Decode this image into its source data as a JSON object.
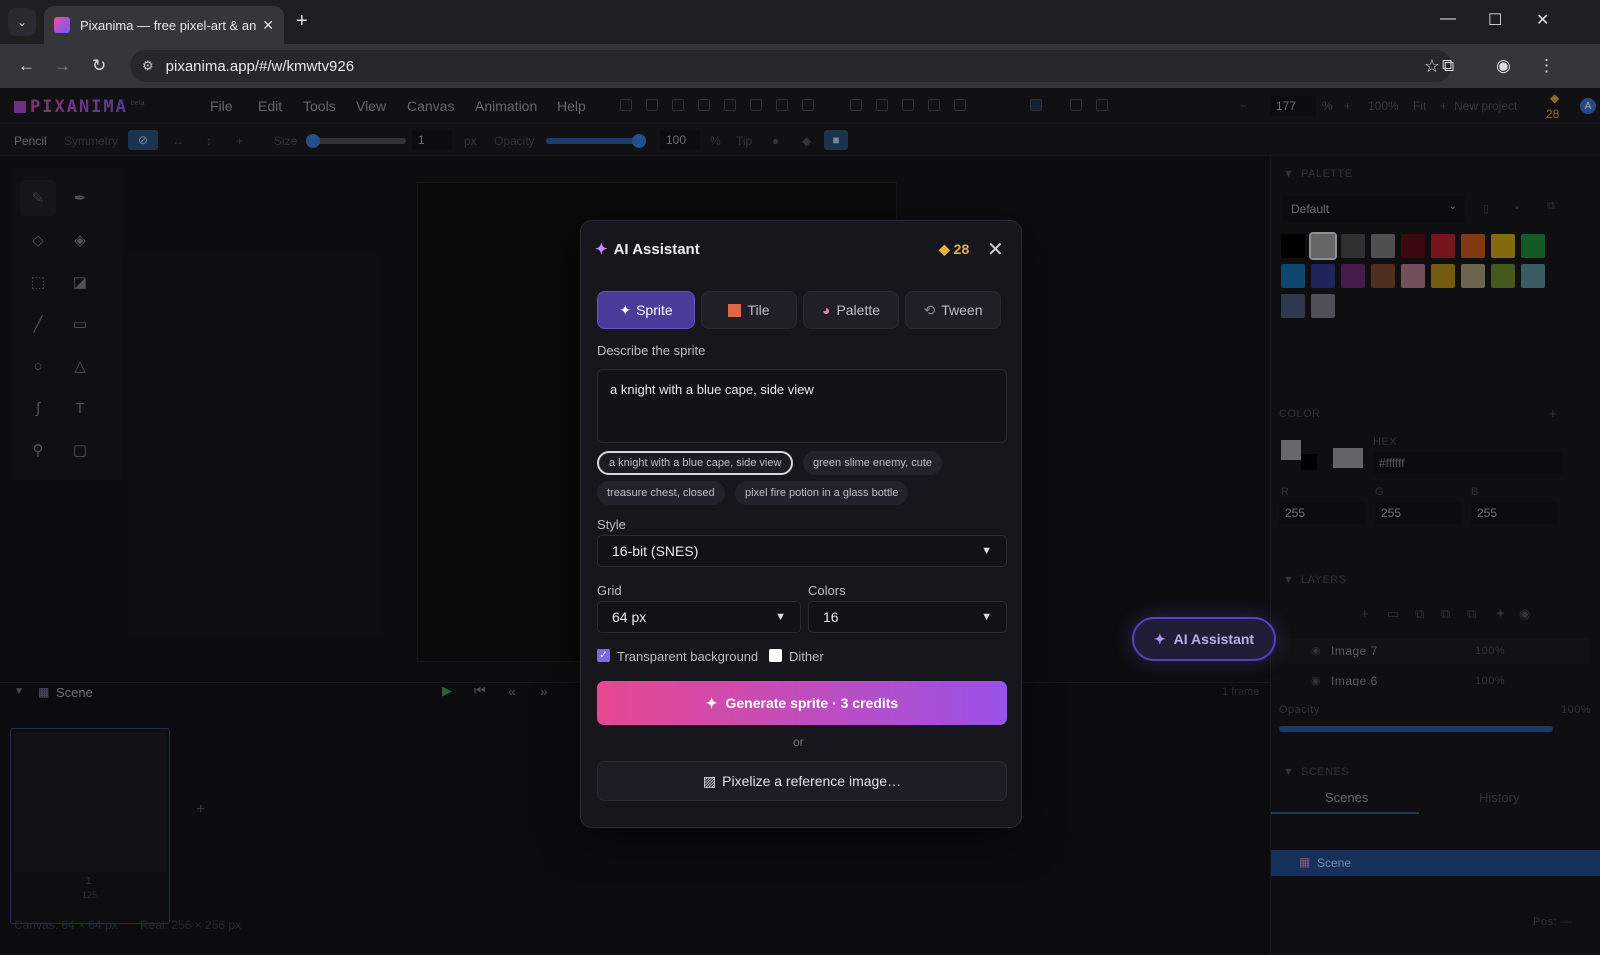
{
  "browser": {
    "tab_title": "Pixanima — free pixel-art & ani",
    "url": "pixanima.app/#/w/kmwtv926"
  },
  "app": {
    "logo": "PIXANIMA",
    "logo_tag": "beta",
    "menu": [
      "File",
      "Edit",
      "Tools",
      "View",
      "Canvas",
      "Animation",
      "Help"
    ],
    "zoom_value": "177",
    "zoom_unit": "%",
    "zoom_reset": "100%",
    "fit_label": "Fit",
    "new_project": "New project",
    "credits": "28",
    "avatar_letter": "A"
  },
  "tool_options": {
    "tool_name": "Pencil",
    "symmetry_label": "Symmetry",
    "size_label": "Size",
    "size_value": "1",
    "size_unit": "px",
    "opacity_label": "Opacity",
    "opacity_value": "100",
    "opacity_unit": "%",
    "tip_label": "Tip"
  },
  "timeline": {
    "scene_label": "Scene",
    "frames_label": "1 frame",
    "frame_number": "1",
    "frame_duration": "125"
  },
  "status": {
    "canvas_size": "Canvas: 64 × 64 px",
    "real_size": "Real: 256 × 256 px",
    "pos_label": "Pos: —"
  },
  "right_panel": {
    "palette_title": "PALETTE",
    "palette_name": "Default",
    "palette_colors": [
      "#000000",
      "#9d9d9d",
      "#4a4a4a",
      "#7a7a7a",
      "#5e0f1b",
      "#b81f2a",
      "#c95a1c",
      "#c9a418",
      "#1f8a3a",
      "#1a6fa8",
      "#2e3a8c",
      "#6e2a72",
      "#7a4a30",
      "#b07a8a",
      "#b08a18",
      "#a89a7a",
      "#6a8a28",
      "#5a8a9a",
      "#4a5a7a",
      "#7a7a8a"
    ],
    "color_title": "COLOR",
    "hex_label": "HEX",
    "hex_value": "#ffffff",
    "r_label": "R",
    "g_label": "G",
    "b_label": "B",
    "r_value": "255",
    "g_value": "255",
    "b_value": "255",
    "layers_title": "LAYERS",
    "layers": [
      {
        "name": "Image 7",
        "opacity": "100%"
      },
      {
        "name": "Image 6",
        "opacity": "100%"
      }
    ],
    "opacity_label": "Opacity",
    "opacity_value": "100%",
    "scenes_title": "SCENES",
    "scenes_tab": "Scenes",
    "history_tab": "History",
    "scene_item": "Scene"
  },
  "ai_float_button": "AI Assistant",
  "modal": {
    "title": "AI Assistant",
    "credits": "28",
    "tabs": [
      "Sprite",
      "Tile",
      "Palette",
      "Tween"
    ],
    "describe_label": "Describe the sprite",
    "prompt_value": "a knight with a blue cape, side view",
    "suggestions": [
      "a knight with a blue cape, side view",
      "green slime enemy, cute",
      "treasure chest, closed",
      "pixel fire potion in a glass bottle"
    ],
    "style_label": "Style",
    "style_value": "16-bit (SNES)",
    "grid_label": "Grid",
    "grid_value": "64 px",
    "colors_label": "Colors",
    "colors_value": "16",
    "transparent_label": "Transparent background",
    "transparent_checked": true,
    "dither_label": "Dither",
    "dither_checked": false,
    "generate_label": "Generate sprite · 3 credits",
    "or_label": "or",
    "pixelize_label": "Pixelize a reference image…"
  },
  "colors": {
    "accent": "#6a54c8",
    "generate_start": "#e8488f",
    "generate_end": "#9a52e8",
    "credit_gold": "#e3b04b"
  }
}
